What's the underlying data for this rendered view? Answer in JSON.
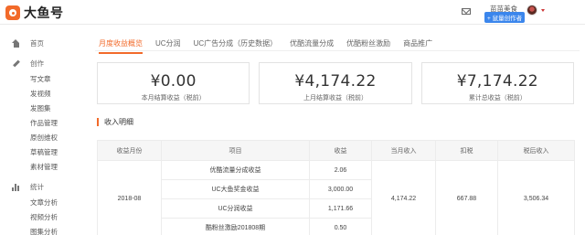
{
  "header": {
    "logo_text": "大鱼号",
    "user_name": "苗苗美食",
    "badge": "+ 鼠量创作者"
  },
  "sidebar": {
    "home": "首页",
    "create": "创作",
    "create_items": [
      "写文章",
      "发视频",
      "发图集",
      "作品管理",
      "原创维权",
      "草稿管理",
      "素材管理"
    ],
    "stats": "统计",
    "stats_items": [
      "文章分析",
      "视频分析",
      "图集分析"
    ]
  },
  "tabs": [
    "月度收益概览",
    "UC分润",
    "UC广告分成（历史数据）",
    "优酷流量分成",
    "优酷粉丝激励",
    "商品推广"
  ],
  "cards": [
    {
      "value": "¥0.00",
      "label": "本月结算收益（税前）"
    },
    {
      "value": "¥4,174.22",
      "label": "上月结算收益（税前）"
    },
    {
      "value": "¥7,174.22",
      "label": "累计总收益（税前）"
    }
  ],
  "section_title": "收入明细",
  "table": {
    "headers": [
      "收益月份",
      "项目",
      "收益",
      "当月收入",
      "扣税",
      "税后收入"
    ],
    "month": "2018-08",
    "rows": [
      {
        "item": "优酷流量分成收益",
        "amount": "2.06"
      },
      {
        "item": "UC大鱼奖金收益",
        "amount": "3,000.00"
      },
      {
        "item": "UC分润收益",
        "amount": "1,171.66"
      },
      {
        "item": "酷粉丝激励201808期",
        "amount": "0.50"
      }
    ],
    "month_income": "4,174.22",
    "tax": "667.88",
    "after_tax": "3,506.34"
  },
  "colors": {
    "accent": "#f26a2a",
    "badge": "#3b86ec"
  }
}
